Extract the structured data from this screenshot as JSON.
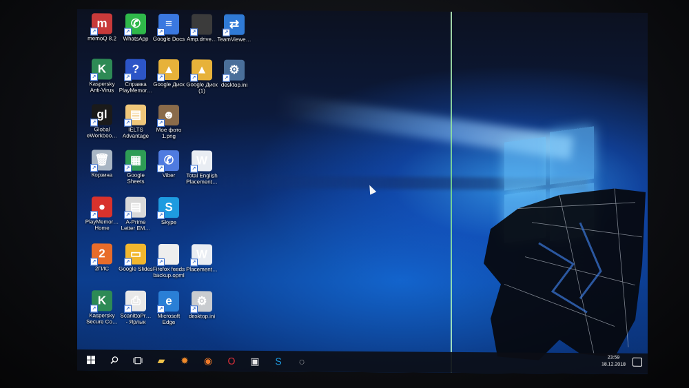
{
  "desktop": {
    "icons": [
      {
        "label": "memoQ 8.2",
        "glyph": "m",
        "color": "#c83a3a"
      },
      {
        "label": "WhatsApp",
        "glyph": "✆",
        "color": "#2fb84a"
      },
      {
        "label": "Google Docs",
        "glyph": "≡",
        "color": "#3a78e0"
      },
      {
        "label": "Amp.drive…",
        "glyph": "",
        "color": "#3b3b3b"
      },
      {
        "label": "TeamViewe…",
        "glyph": "⇄",
        "color": "#2f7ad6"
      },
      {
        "label": "Kaspersky\nAnti-Virus",
        "glyph": "K",
        "color": "#2d8a55"
      },
      {
        "label": "Справка\nPlayMemor…",
        "glyph": "?",
        "color": "#2c55c7"
      },
      {
        "label": "Google Диск",
        "glyph": "▲",
        "color": "#e7b23a"
      },
      {
        "label": "Google Диск\n(1)",
        "glyph": "▲",
        "color": "#e7b23a"
      },
      {
        "label": "desktop.ini",
        "glyph": "⚙",
        "color": "#4a6f9a"
      },
      {
        "label": "Global\neWorkboo…",
        "glyph": "gl",
        "color": "#1a1a1a"
      },
      {
        "label": "IELTS\nAdvantage",
        "glyph": "▤",
        "color": "#f0c77a"
      },
      {
        "label": "Мое фото\n1.png",
        "glyph": "☻",
        "color": "#8a6b4a"
      },
      {
        "label": "Корзина",
        "glyph": "🗑",
        "color": "#a9b6c4"
      },
      {
        "label": "Google\nSheets",
        "glyph": "▦",
        "color": "#2e9d55"
      },
      {
        "label": "Viber",
        "glyph": "✆",
        "color": "#4f7be0"
      },
      {
        "label": "Total English\nPlacement…",
        "glyph": "W",
        "color": "#e9edf3"
      },
      {
        "label": "PlayMemor…\nHome",
        "glyph": "●",
        "color": "#d8322c"
      },
      {
        "label": "A-Prime\nLetter EM…",
        "glyph": "▤",
        "color": "#d9d9d9"
      },
      {
        "label": "Skype",
        "glyph": "S",
        "color": "#1e9be0"
      },
      {
        "label": "2ГИС",
        "glyph": "2",
        "color": "#e86c2a"
      },
      {
        "label": "Google Slides",
        "glyph": "▭",
        "color": "#f2b72e"
      },
      {
        "label": "Firefox feeds\nbackup.opml",
        "glyph": "",
        "color": "#eeeeee"
      },
      {
        "label": "Placement…",
        "glyph": "W",
        "color": "#e9edf3"
      },
      {
        "label": "Kaspersky\nSecure Co…",
        "glyph": "K",
        "color": "#2d8a55"
      },
      {
        "label": "ScanittoPr…\n- Ярлык",
        "glyph": "⎙",
        "color": "#e8e8e8"
      },
      {
        "label": "Microsoft\nEdge",
        "glyph": "e",
        "color": "#2a7fd6"
      },
      {
        "label": "desktop.ini",
        "glyph": "⚙",
        "color": "#c9ccd0"
      }
    ]
  },
  "taskbar": {
    "start_icon": "windows-logo-icon",
    "search_icon": "search-icon",
    "taskview_icon": "task-view-icon",
    "pinned": [
      {
        "name": "file-explorer-icon",
        "glyph": "▰",
        "color": "#f0c24a"
      },
      {
        "name": "settings-icon",
        "glyph": "✹",
        "color": "#f08a2a"
      },
      {
        "name": "firefox-icon",
        "glyph": "◉",
        "color": "#f07a2a"
      },
      {
        "name": "opera-icon",
        "glyph": "O",
        "color": "#e0303a"
      },
      {
        "name": "photos-icon",
        "glyph": "▣",
        "color": "#e9e9e9"
      },
      {
        "name": "skype-taskbar-icon",
        "glyph": "S",
        "color": "#1e9be0"
      },
      {
        "name": "chat-icon",
        "glyph": "◌",
        "color": "#e9e9e9"
      }
    ],
    "clock": {
      "time": "23:59",
      "date": "18.12.2018"
    }
  }
}
